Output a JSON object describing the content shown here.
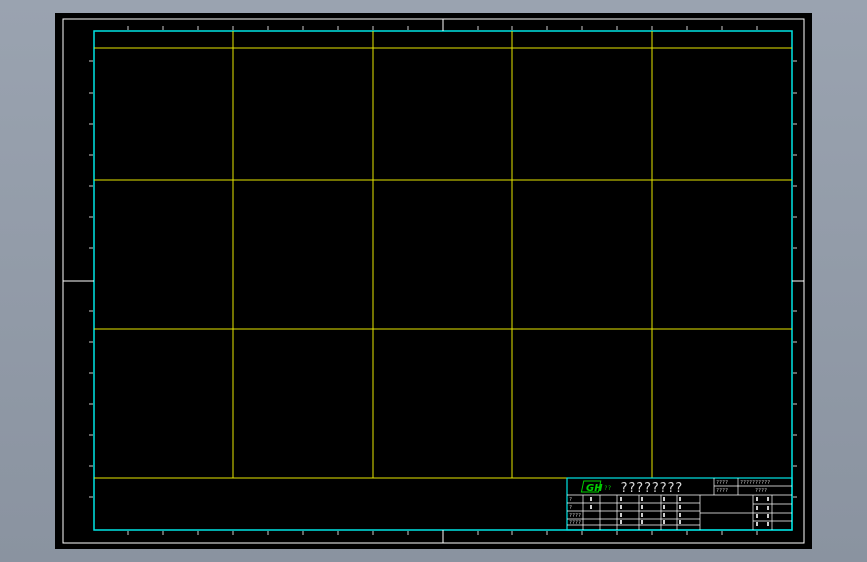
{
  "colors": {
    "background": "#8f98a5",
    "canvas": "#000000",
    "frame": "#00e5e5",
    "grid": "#e6e600",
    "logo": "#00d000",
    "text": "#d8d8d8"
  },
  "title_block": {
    "logo_text": "GH",
    "company_code": "??",
    "drawing_title": "????????",
    "top_right": [
      "????",
      "??????????",
      "????"
    ],
    "small_rows": [
      "?",
      "?",
      "????",
      "????"
    ]
  }
}
